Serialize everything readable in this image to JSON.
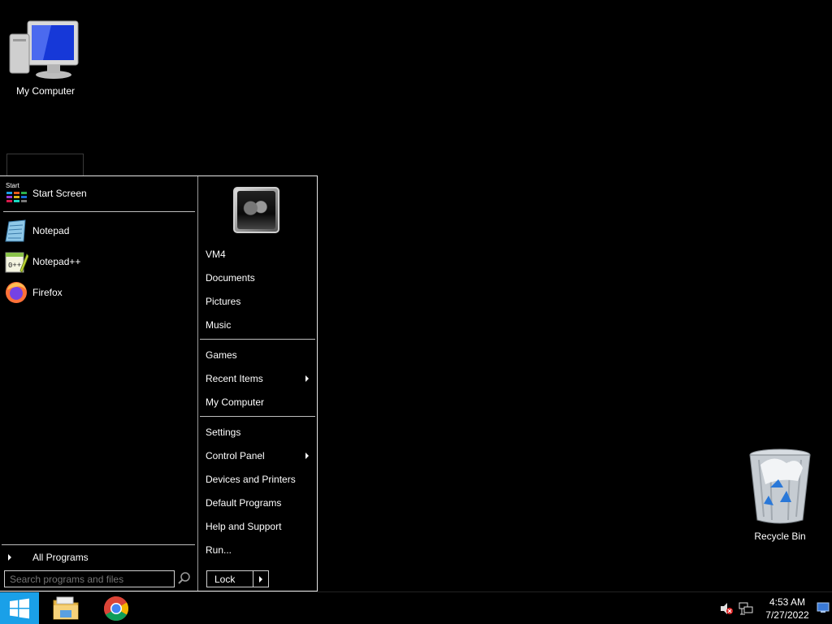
{
  "desktop": {
    "icons": [
      {
        "label": "My Computer"
      },
      {
        "label": "Recycle Bin"
      }
    ]
  },
  "start_menu": {
    "start_screen": {
      "label": "Start Screen",
      "tile_caption": "Start"
    },
    "pinned": [
      {
        "label": "Notepad",
        "icon": "notepad-icon"
      },
      {
        "label": "Notepad++",
        "icon": "notepad-plus-plus-icon"
      },
      {
        "label": "Firefox",
        "icon": "firefox-icon"
      }
    ],
    "all_programs_label": "All Programs",
    "search_placeholder": "Search programs and files",
    "right_items": [
      {
        "label": "VM4"
      },
      {
        "label": "Documents"
      },
      {
        "label": "Pictures"
      },
      {
        "label": "Music"
      },
      {
        "label": "Games"
      },
      {
        "label": "Recent Items",
        "submenu": true
      },
      {
        "label": "My Computer"
      },
      {
        "label": "Settings"
      },
      {
        "label": "Control Panel",
        "submenu": true
      },
      {
        "label": "Devices and Printers"
      },
      {
        "label": "Default Programs"
      },
      {
        "label": "Help and Support"
      },
      {
        "label": "Run..."
      }
    ],
    "power_button_label": "Lock"
  },
  "taskbar": {
    "apps": [
      {
        "name": "file-explorer-icon"
      },
      {
        "name": "chrome-icon"
      }
    ],
    "clock": {
      "time": "4:53 AM",
      "date": "7/27/2022"
    },
    "start_color": "#1aa0e8"
  }
}
